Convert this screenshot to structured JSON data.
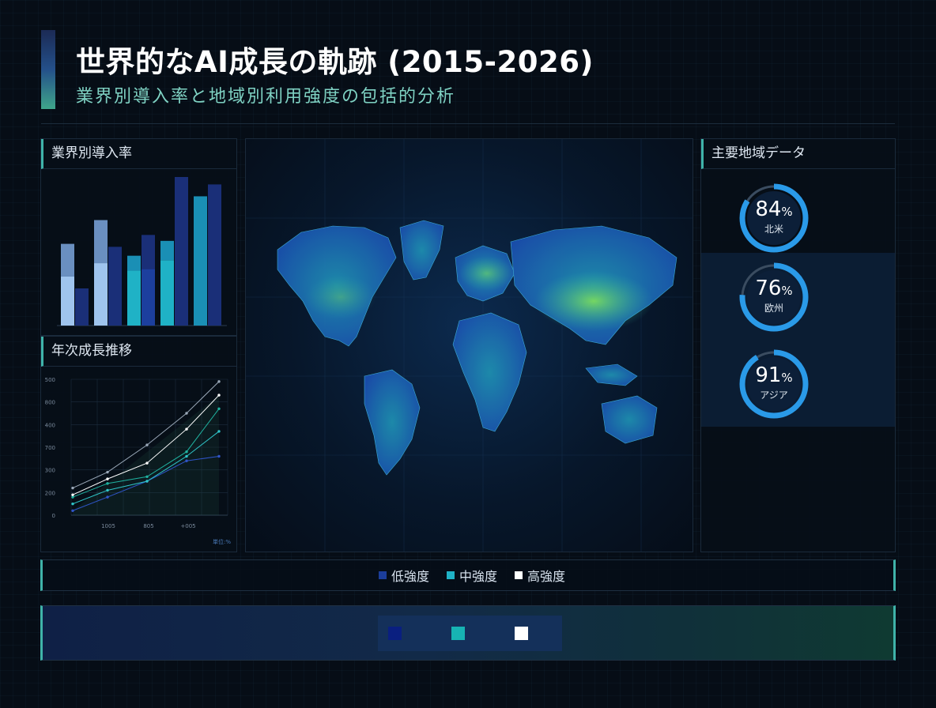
{
  "header": {
    "title": "世界的なAI成長の軌跡 (2015-2026)",
    "subtitle": "業界別導入率と地域別利用強度の包括的分析"
  },
  "colors": {
    "accent": "#3fb3a9",
    "low": "#1b3d9a",
    "mid": "#1fb2c6",
    "high": "#ffffff",
    "pale_blue": "#6a9ddc"
  },
  "industry_panel": {
    "title": "業界別導入率",
    "chart_data": {
      "type": "bar",
      "note": "unlabeled stacked bar groups; values approximated in relative units 0-100",
      "groups": [
        {
          "bars": [
            {
              "bottom": 33,
              "top": 22,
              "style": "pale"
            },
            {
              "value": 25,
              "style": "navy"
            }
          ]
        },
        {
          "bars": [
            {
              "bottom": 42,
              "top": 29,
              "style": "pale"
            },
            {
              "value": 53,
              "style": "navy"
            }
          ]
        },
        {
          "bars": [
            {
              "bottom": 37,
              "top": 10,
              "style": "cyan"
            },
            {
              "bottom": 38,
              "top": 23,
              "style": "navy"
            }
          ]
        },
        {
          "bars": [
            {
              "bottom": 44,
              "top": 13,
              "style": "cyan"
            },
            {
              "value": 100,
              "style": "navy"
            }
          ]
        },
        {
          "bars": [
            {
              "value": 87,
              "style": "cyan"
            },
            {
              "value": 95,
              "style": "navy"
            }
          ]
        }
      ]
    }
  },
  "growth_panel": {
    "title": "年次成長推移",
    "unit_label": "単位:%",
    "chart_data": {
      "type": "line",
      "y_ticks": [
        "0",
        "200",
        "300",
        "700",
        "400",
        "800",
        "500"
      ],
      "x_ticks": [
        "1005",
        "805",
        "+005"
      ],
      "ylim": [
        0,
        6
      ],
      "series": [
        {
          "values": [
            0.2,
            0.8,
            1.5,
            2.4,
            2.6
          ],
          "color": "#2f55c8"
        },
        {
          "values": [
            0.5,
            1.1,
            1.5,
            2.6,
            3.7
          ],
          "color": "#2fc4c8"
        },
        {
          "values": [
            0.8,
            1.4,
            1.7,
            2.8,
            4.7
          ],
          "color": "#1fb2a0"
        },
        {
          "values": [
            0.9,
            1.6,
            2.3,
            3.8,
            5.3
          ],
          "color": "#ffffff"
        },
        {
          "values": [
            1.2,
            1.9,
            3.1,
            4.5,
            5.9
          ],
          "color": "#9aa8b8"
        }
      ]
    }
  },
  "regions": {
    "title": "主要地域データ",
    "items": [
      {
        "value": "84",
        "unit": "%",
        "label": "北米",
        "fraction": 0.84
      },
      {
        "value": "76",
        "unit": "%",
        "label": "欧州",
        "fraction": 0.76
      },
      {
        "value": "91",
        "unit": "%",
        "label": "アジア",
        "fraction": 0.91
      }
    ]
  },
  "legend": {
    "items": [
      {
        "label": "低強度",
        "color": "#1b3d9a"
      },
      {
        "label": "中強度",
        "color": "#1fb2c6"
      },
      {
        "label": "高強度",
        "color": "#ffffff"
      }
    ]
  },
  "bottom_legend": {
    "swatches": [
      "#0a1f80",
      "#17b3b3",
      "#ffffff"
    ]
  }
}
